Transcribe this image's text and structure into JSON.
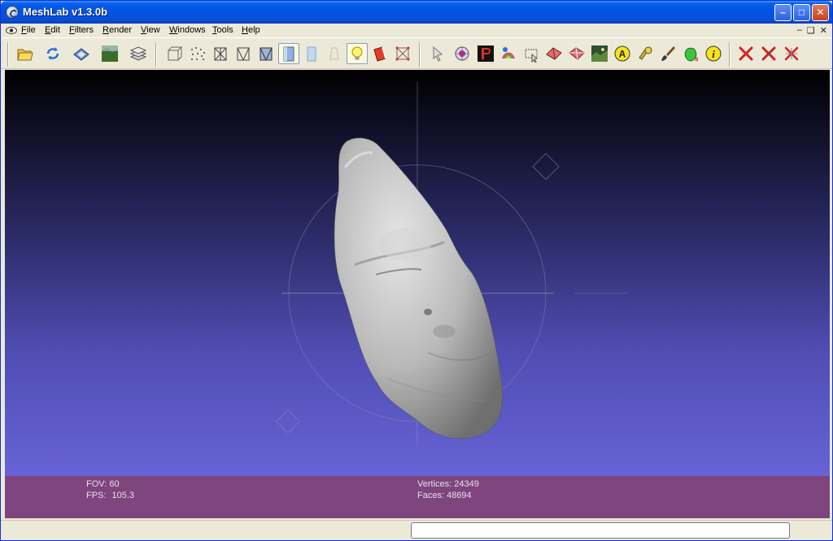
{
  "window": {
    "title": "MeshLab v1.3.0b"
  },
  "menu": {
    "items": [
      {
        "id": "file",
        "label": "File"
      },
      {
        "id": "edit",
        "label": "Edit"
      },
      {
        "id": "filters",
        "label": "Filters"
      },
      {
        "id": "render",
        "label": "Render"
      },
      {
        "id": "view",
        "label": "View"
      },
      {
        "id": "windows",
        "label": "Windows"
      },
      {
        "id": "tools",
        "label": "Tools"
      },
      {
        "id": "help",
        "label": "Help"
      }
    ]
  },
  "toolbar": {
    "groups": [
      [
        "open-icon",
        "reload-icon",
        "save-icon",
        "snapshot-icon",
        "layers-icon"
      ],
      [
        "bbox-icon",
        "points-icon",
        "wireframe-icon",
        "hidden-lines-icon",
        "flat-lines-icon",
        "flat-icon",
        "smooth-icon",
        "texture-icon",
        "light-icon",
        "backface-icon",
        "vertex-normal-icon"
      ],
      [
        "select-icon",
        "info-icon",
        "pickpoints-icon",
        "paint-icon",
        "select-faces-icon",
        "select-vertices-icon",
        "select-connected-icon",
        "raster-icon",
        "measure-icon",
        "align-icon",
        "brush-icon",
        "scale-icon",
        "about-icon"
      ],
      [
        "delete-faces-icon",
        "delete-vertices-icon",
        "delete-selection-icon"
      ]
    ],
    "active": "light-icon"
  },
  "viewport": {
    "fov_label": "FOV:",
    "fov_value": "60",
    "fps_label": "FPS:",
    "fps_value": "105.3",
    "vertices_label": "Vertices:",
    "vertices_value": "24349",
    "faces_label": "Faces:",
    "faces_value": "48694"
  },
  "colors": {
    "info_bar": "#7e457f",
    "viewport_top": "#000000",
    "viewport_bottom": "#6763d6",
    "mesh": "#b9b9b9"
  }
}
